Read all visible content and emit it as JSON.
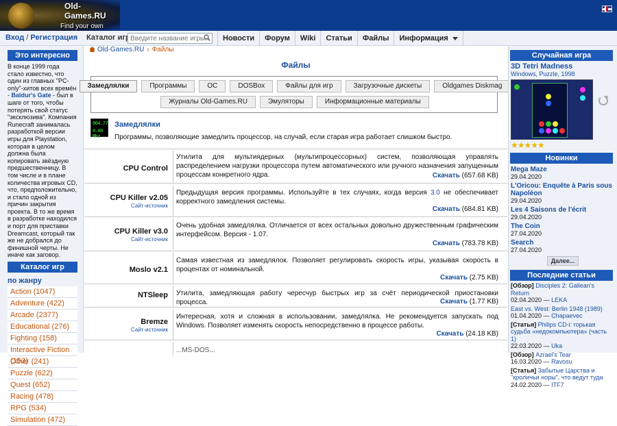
{
  "header": {
    "logo_title": "Old-Games.RU",
    "logo_tagline": "Find your own world"
  },
  "navbar": {
    "login": "Вход",
    "sep": " / ",
    "register": "Регистрация",
    "catalog_label": "Каталог игр",
    "search_placeholder": "Введите название игры...",
    "items": [
      "Новости",
      "Форум",
      "Wiki",
      "Статьи",
      "Файлы",
      "Информация"
    ]
  },
  "left": {
    "interesting_title": "Это интересно",
    "interesting_before": "В конце 1999 года стало известно, что один из главных \"PC-only\"-хитов всех времён - ",
    "interesting_link": "Baldur's Gate",
    "interesting_after": " - был в шаге от того, чтобы потерять свой статус \"эксклюзива\". Компания Runecraft занималась разработкой версии игры для Playstation, которая в целом должна была копировать звёздную предшественницу. В том числе и в плане количества игровых CD, что, предположительно, и стало одной из причин закрытия проекта. В то же время в разработке находился и порт для приставки Dreamcast, который так же не добрался до финишной черты. Не иначе как заговор.",
    "catalog_title": "Каталог игр",
    "by_genre": "по жанру",
    "genres": [
      "Action (1047)",
      "Adventure (422)",
      "Arcade (2377)",
      "Educational (276)",
      "Fighting (158)",
      "Interactive Fiction (153)",
      "Other (241)",
      "Puzzle (622)",
      "Quest (652)",
      "Racing (478)",
      "RPG (534)",
      "Simulation (472)"
    ]
  },
  "main": {
    "breadcrumb_home": "Old-Games.RU",
    "breadcrumb_current": "Файлы",
    "title": "Файлы",
    "categories_row1": [
      "Замедлялки",
      "Программы",
      "ОС",
      "DOSBox",
      "Файлы для игр",
      "Загрузочные дискеты",
      "Oldgames Diskmag"
    ],
    "categories_row2": [
      "Журналы Old-Games.RU",
      "Эмуляторы",
      "Информационные материалы"
    ],
    "section_icon_line1": "004.77",
    "section_icon_line2": "0.08 Mhz",
    "section_title": "Замедлялки",
    "section_desc": "Программы, позволяющие замедлить процессор, на случай, если старая игра работает слишком быстро.",
    "download_label": "Скачать",
    "source_label": "Сайт-источник",
    "files": [
      {
        "name": "CPU Control",
        "desc": "Утилита для мультиядерных (мультипроцессорных) систем, позволяющая управлять распределением нагрузки процессора путем автоматического или ручного назначения запущенным процессам конкретного ядра.",
        "size": "(657.68 KB)"
      },
      {
        "name": "CPU Killer v2.05",
        "desc_a": "Предыдущая версия программы. Используйте в тех случаях, когда версия ",
        "desc_b": "3.0",
        "desc_c": " не обеспечивает корректного замедления системы.",
        "size": "(684.81 KB)"
      },
      {
        "name": "CPU Killer v3.0",
        "desc": "Очень удобная замедлялка. Отличается от всех остальных довольно дружественным графическим интерфейсом. Версия - 1.07.",
        "size": "(783.78 KB)"
      },
      {
        "name": "Moslo v2.1",
        "desc": "Самая известная из замедлялок. Позволяет регулировать скорость игры, указывая скорость в процентах от номинальной.",
        "size": "(2.75 KB)"
      },
      {
        "name": "NTSleep",
        "desc": "Утилита, замедляющая работу чересчур быстрых игр за счёт периодической приостановки процесса.",
        "size": "(1.77 KB)"
      },
      {
        "name": "Bremze",
        "desc": "Интересная, хотя и сложная в использовании, замедлялка. Не рекомендуется запускать под Windows. Позволяет изменять скорость непосредственно в процессе работы.",
        "size": "(24.18 KB)"
      }
    ],
    "partial_row_text": "...MS-DOS..."
  },
  "right": {
    "random_title": "Случайная игра",
    "random_game": "3D Tetri Madness",
    "random_sub": "Windows, Puzzle, 1998",
    "rating": "★★★★★",
    "rating_value": 4.5,
    "news_title": "Новинки",
    "news": [
      {
        "title": "Mega Maze",
        "date": "29.04.2020"
      },
      {
        "title": "L'Oricou: Enquête à Paris sous Napoléon",
        "date": "29.04.2020"
      },
      {
        "title": "Les 4 Saisons de l'écrit",
        "date": "29.04.2020"
      },
      {
        "title": "The Coin",
        "date": "27.04.2020"
      },
      {
        "title": "Search",
        "date": "27.04.2020"
      }
    ],
    "more": "Далее...",
    "articles_title": "Последние статьи",
    "articles": [
      {
        "tag": "[Обзор]",
        "title": " Disciples 2: Gallean's Return",
        "date": "02.04.2020",
        "author": "LEKA"
      },
      {
        "tag": "",
        "title": "East vs. West: Berlin 1948 (1989)",
        "date": "01.04.2020",
        "author": "Chapaevec"
      },
      {
        "tag": "[Статья]",
        "title": " Philips CD-i: горькая судьба «недокомпьютера» (часть 1)",
        "date": "22.03.2020",
        "author": "Uka"
      },
      {
        "tag": "[Обзор]",
        "title": " Azrael's Tear",
        "date": "16.03.2020",
        "author": "Ravosu"
      },
      {
        "tag": "[Статья]",
        "title": " Забытые Царства и \"кроличьи норы\", что ведут туда",
        "date": "24.02.2020",
        "author": "ITF7"
      }
    ]
  }
}
